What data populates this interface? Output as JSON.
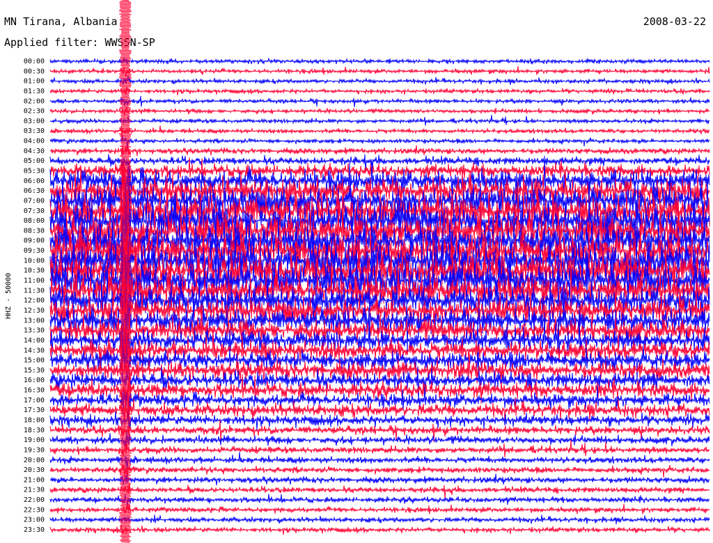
{
  "header": {
    "station": "MN Tirana, Albania",
    "filter": "Applied filter: WWSSN-SP",
    "date": "2008-03-22"
  },
  "chart_data": {
    "type": "line",
    "title": "MN Tirana, Albania",
    "subtitle": "Applied filter: WWSSN-SP",
    "date": "2008-03-22",
    "ylabel": "HHZ - 50000",
    "row_labels": [
      "00:00",
      "00:30",
      "01:00",
      "01:30",
      "02:00",
      "02:30",
      "03:00",
      "03:30",
      "04:00",
      "04:30",
      "05:00",
      "05:30",
      "06:00",
      "06:30",
      "07:00",
      "07:30",
      "08:00",
      "08:30",
      "09:00",
      "09:30",
      "10:00",
      "10:30",
      "11:00",
      "11:30",
      "12:00",
      "12:30",
      "13:00",
      "13:30",
      "14:00",
      "14:30",
      "15:00",
      "15:30",
      "16:00",
      "16:30",
      "17:00",
      "17:30",
      "18:00",
      "18:30",
      "19:00",
      "19:30",
      "20:00",
      "20:30",
      "21:00",
      "21:30",
      "22:00",
      "22:30",
      "23:00",
      "23:30"
    ],
    "series_colors": [
      "#0000ff",
      "#ff0033"
    ],
    "relative_amplitude": [
      1,
      1,
      1,
      1,
      1,
      1,
      1,
      1,
      1,
      1.3,
      1.8,
      3,
      5,
      6,
      7,
      7.5,
      8,
      8,
      8,
      8,
      8,
      8,
      8,
      7,
      6.5,
      6,
      5.5,
      5,
      4.5,
      4.5,
      4,
      4,
      3.5,
      3.5,
      3,
      3,
      2.5,
      2,
      1.8,
      1.6,
      1.5,
      1.4,
      1.4,
      1.3,
      1.3,
      1.2,
      1.2,
      1.2
    ],
    "events": [
      {
        "row_label": "00:00",
        "description": "large transient, full-scale across all rows"
      }
    ],
    "grid": false
  }
}
